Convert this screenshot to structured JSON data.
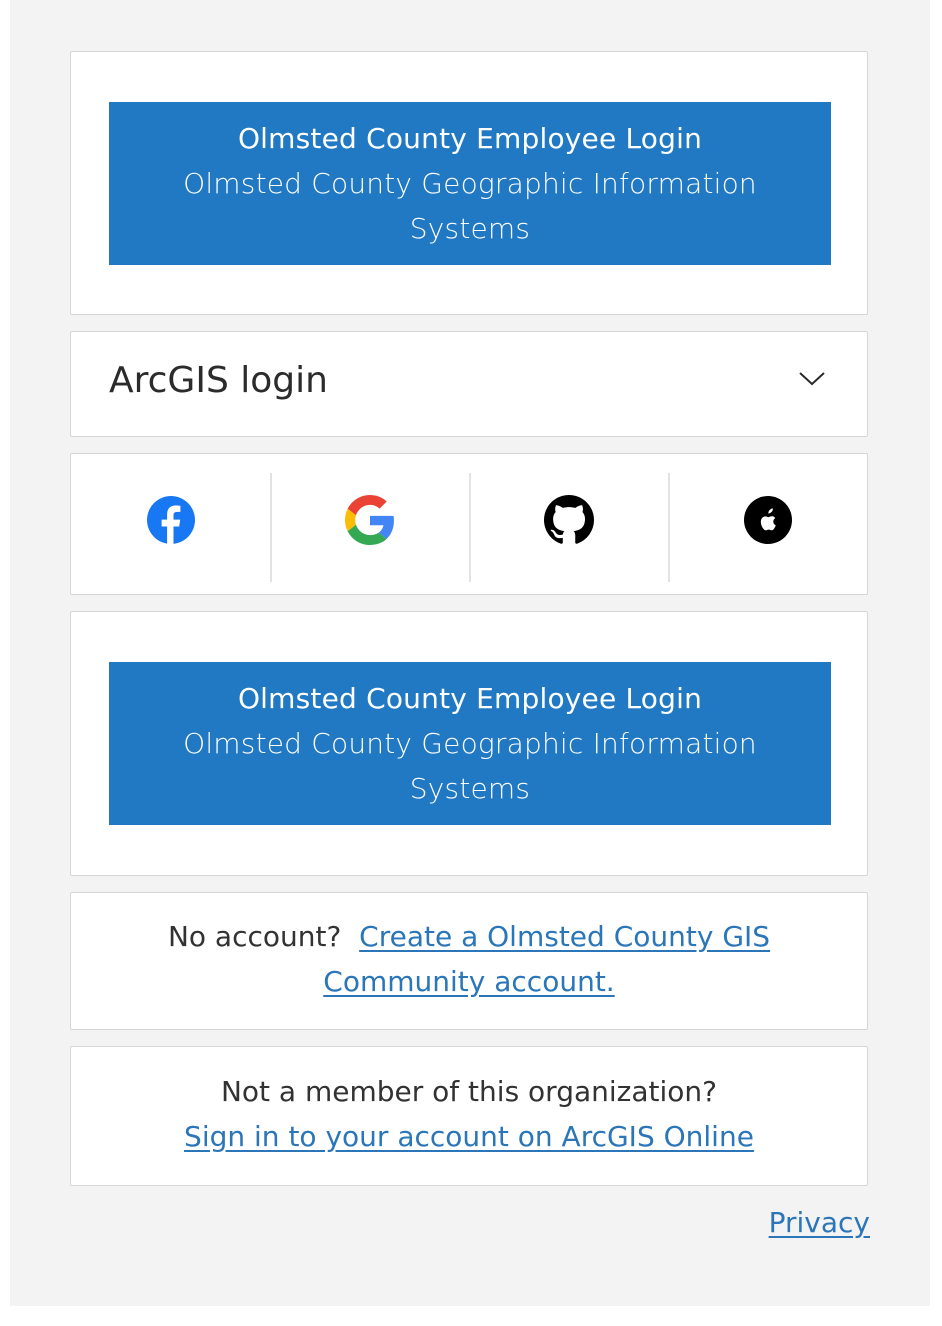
{
  "sso_top": {
    "line1": "Olmsted County Employee Login",
    "line2": "Olmsted County Geographic Information",
    "line3": "Systems"
  },
  "arcgis_login": {
    "title": "ArcGIS login",
    "toggle_icon": "chevron-down-icon"
  },
  "social_logins": [
    {
      "name": "Facebook",
      "icon": "facebook-icon",
      "color": "#1877f2"
    },
    {
      "name": "Google",
      "icon": "google-icon",
      "color": "#4285f4"
    },
    {
      "name": "GitHub",
      "icon": "github-icon",
      "color": "#000000"
    },
    {
      "name": "Apple",
      "icon": "apple-icon",
      "color": "#000000"
    }
  ],
  "sso_bottom": {
    "line1": "Olmsted County Employee Login",
    "line2": "Olmsted County Geographic Information",
    "line3": "Systems"
  },
  "no_account": {
    "prefix": "No account?",
    "link_text": "Create a Olmsted County GIS Community account."
  },
  "not_member": {
    "prefix": "Not a member of this organization?",
    "link_text": "Sign in to your account on ArcGIS Online"
  },
  "footer": {
    "privacy_label": "Privacy"
  },
  "colors": {
    "accent_button": "#2179c4",
    "link": "#2a76b8",
    "page_background": "#f3f3f3"
  }
}
